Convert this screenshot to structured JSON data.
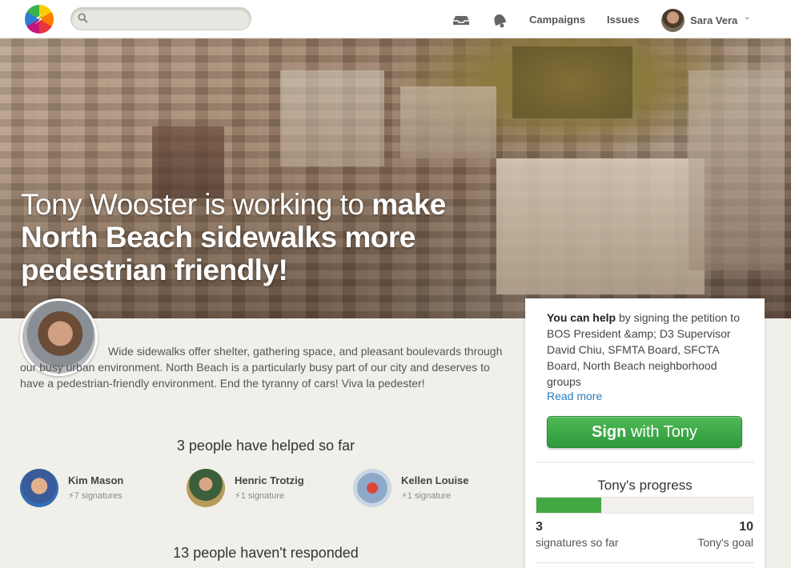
{
  "nav": {
    "logo_glyph": "⚡",
    "search_placeholder": "",
    "icons": [
      "messages-icon",
      "notifications-icon"
    ],
    "links": [
      "Campaigns",
      "Issues"
    ],
    "user": "Sara Vera"
  },
  "hero": {
    "title_light": "Tony Wooster is working to ",
    "title_bold": "make North Beach sidewalks more pedestrian friendly!"
  },
  "description": "Wide sidewalks offer shelter, gathering space, and pleasant boulevards through our busy urban environment. North Beach is a particularly busy part of our city and deserves to have a pedestrian-friendly environment. End the tyranny of cars! Viva la pedester!",
  "helped": {
    "title": "3 people have helped so far",
    "people": [
      {
        "name": "Kim Mason",
        "signatures": "7 signatures"
      },
      {
        "name": "Henric Trotzig",
        "signatures": "1 signature"
      },
      {
        "name": "Kellen Louise",
        "signatures": "1 signature"
      }
    ]
  },
  "not_responded": "13 people haven't responded",
  "panel": {
    "help_bold": "You can help",
    "help_rest": " by signing the petition to BOS President &amp; D3 Supervisor David Chiu, SFMTA Board, SFCTA Board, North Beach neighborhood groups",
    "read_more": "Read more",
    "sign_bold": "Sign",
    "sign_rest": " with Tony",
    "progress_title": "Tony's progress",
    "progress_fraction": 0.3,
    "so_far_value": "3",
    "so_far_label": "signatures so far",
    "goal_value": "10",
    "goal_label": "Tony's goal"
  },
  "colors": {
    "accent_green": "#43a843",
    "link_blue": "#2a7bbf"
  }
}
